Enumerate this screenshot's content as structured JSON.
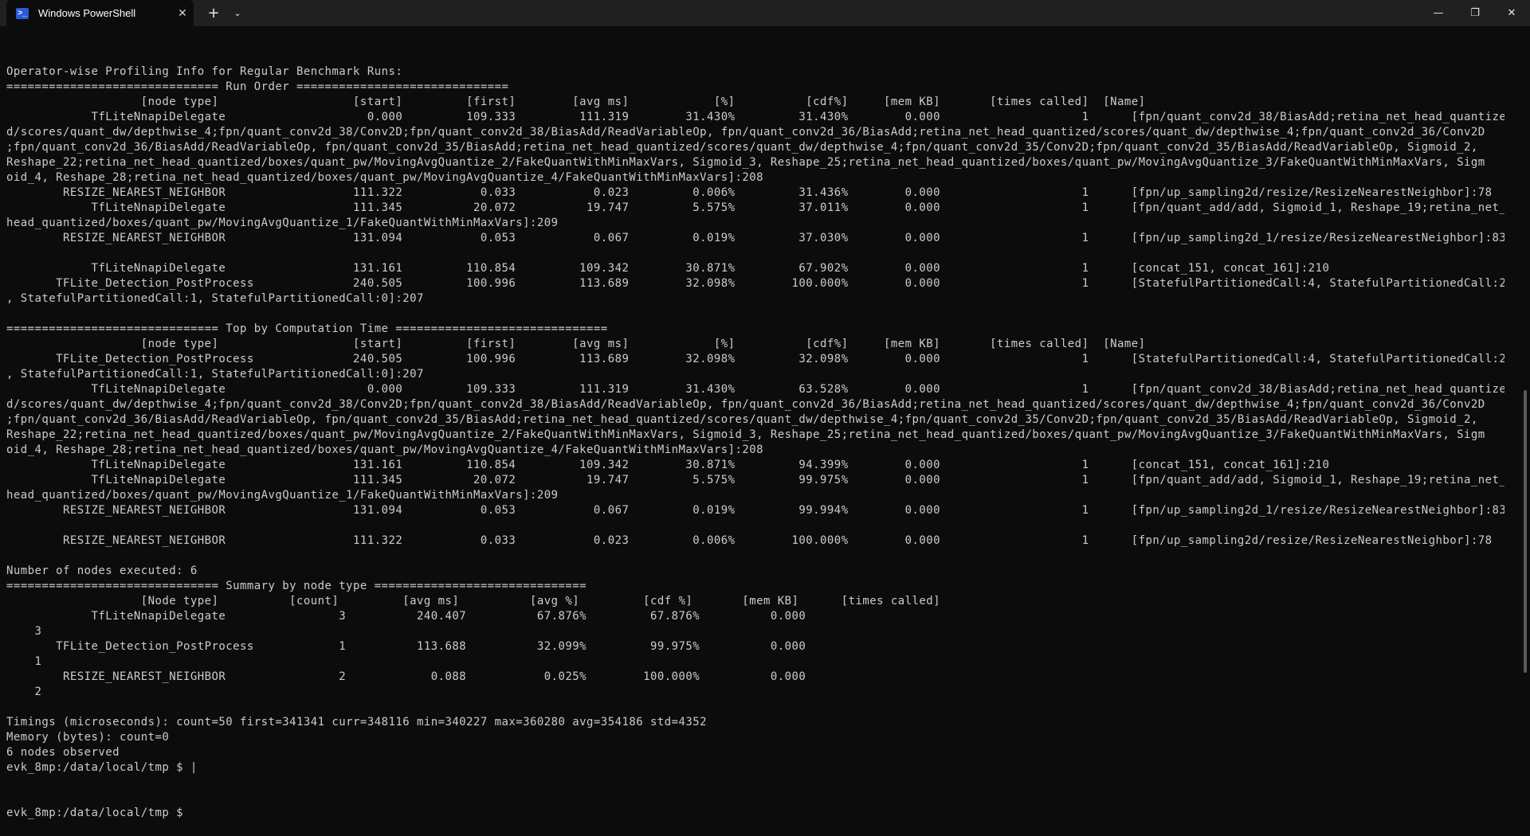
{
  "window": {
    "tab_title": "Windows PowerShell",
    "tab_icon": "powershell-icon",
    "close_tab_glyph": "✕",
    "new_tab_glyph": "+",
    "dropdown_glyph": "⌄",
    "minimize_glyph": "—",
    "maximize_glyph": "❐",
    "close_glyph": "✕"
  },
  "terminal": {
    "lines": [
      "Operator-wise Profiling Info for Regular Benchmark Runs:",
      "============================== Run Order ==============================",
      "                   [node type]                   [start]         [first]        [avg ms]            [%]          [cdf%]     [mem KB]       [times called]  [Name]",
      "            TfLiteNnapiDelegate                    0.000         109.333         111.319        31.430%         31.430%        0.000                    1      [fpn/quant_conv2d_38/BiasAdd;retina_net_head_quantize",
      "d/scores/quant_dw/depthwise_4;fpn/quant_conv2d_38/Conv2D;fpn/quant_conv2d_38/BiasAdd/ReadVariableOp, fpn/quant_conv2d_36/BiasAdd;retina_net_head_quantized/scores/quant_dw/depthwise_4;fpn/quant_conv2d_36/Conv2D",
      ";fpn/quant_conv2d_36/BiasAdd/ReadVariableOp, fpn/quant_conv2d_35/BiasAdd;retina_net_head_quantized/scores/quant_dw/depthwise_4;fpn/quant_conv2d_35/Conv2D;fpn/quant_conv2d_35/BiasAdd/ReadVariableOp, Sigmoid_2,",
      "Reshape_22;retina_net_head_quantized/boxes/quant_pw/MovingAvgQuantize_2/FakeQuantWithMinMaxVars, Sigmoid_3, Reshape_25;retina_net_head_quantized/boxes/quant_pw/MovingAvgQuantize_3/FakeQuantWithMinMaxVars, Sigm",
      "oid_4, Reshape_28;retina_net_head_quantized/boxes/quant_pw/MovingAvgQuantize_4/FakeQuantWithMinMaxVars]:208",
      "        RESIZE_NEAREST_NEIGHBOR                  111.322           0.033           0.023         0.006%         31.436%        0.000                    1      [fpn/up_sampling2d/resize/ResizeNearestNeighbor]:78",
      "            TfLiteNnapiDelegate                  111.345          20.072          19.747         5.575%         37.011%        0.000                    1      [fpn/quant_add/add, Sigmoid_1, Reshape_19;retina_net_",
      "head_quantized/boxes/quant_pw/MovingAvgQuantize_1/FakeQuantWithMinMaxVars]:209",
      "        RESIZE_NEAREST_NEIGHBOR                  131.094           0.053           0.067         0.019%         37.030%        0.000                    1      [fpn/up_sampling2d_1/resize/ResizeNearestNeighbor]:83",
      "",
      "            TfLiteNnapiDelegate                  131.161         110.854         109.342        30.871%         67.902%        0.000                    1      [concat_151, concat_161]:210",
      "       TFLite_Detection_PostProcess              240.505         100.996         113.689        32.098%        100.000%        0.000                    1      [StatefulPartitionedCall:4, StatefulPartitionedCall:2",
      ", StatefulPartitionedCall:1, StatefulPartitionedCall:0]:207",
      "",
      "============================== Top by Computation Time ==============================",
      "                   [node type]                   [start]         [first]        [avg ms]            [%]          [cdf%]     [mem KB]       [times called]  [Name]",
      "       TFLite_Detection_PostProcess              240.505         100.996         113.689        32.098%         32.098%        0.000                    1      [StatefulPartitionedCall:4, StatefulPartitionedCall:2",
      ", StatefulPartitionedCall:1, StatefulPartitionedCall:0]:207",
      "            TfLiteNnapiDelegate                    0.000         109.333         111.319        31.430%         63.528%        0.000                    1      [fpn/quant_conv2d_38/BiasAdd;retina_net_head_quantize",
      "d/scores/quant_dw/depthwise_4;fpn/quant_conv2d_38/Conv2D;fpn/quant_conv2d_38/BiasAdd/ReadVariableOp, fpn/quant_conv2d_36/BiasAdd;retina_net_head_quantized/scores/quant_dw/depthwise_4;fpn/quant_conv2d_36/Conv2D",
      ";fpn/quant_conv2d_36/BiasAdd/ReadVariableOp, fpn/quant_conv2d_35/BiasAdd;retina_net_head_quantized/scores/quant_dw/depthwise_4;fpn/quant_conv2d_35/Conv2D;fpn/quant_conv2d_35/BiasAdd/ReadVariableOp, Sigmoid_2,",
      "Reshape_22;retina_net_head_quantized/boxes/quant_pw/MovingAvgQuantize_2/FakeQuantWithMinMaxVars, Sigmoid_3, Reshape_25;retina_net_head_quantized/boxes/quant_pw/MovingAvgQuantize_3/FakeQuantWithMinMaxVars, Sigm",
      "oid_4, Reshape_28;retina_net_head_quantized/boxes/quant_pw/MovingAvgQuantize_4/FakeQuantWithMinMaxVars]:208",
      "            TfLiteNnapiDelegate                  131.161         110.854         109.342        30.871%         94.399%        0.000                    1      [concat_151, concat_161]:210",
      "            TfLiteNnapiDelegate                  111.345          20.072          19.747         5.575%         99.975%        0.000                    1      [fpn/quant_add/add, Sigmoid_1, Reshape_19;retina_net_",
      "head_quantized/boxes/quant_pw/MovingAvgQuantize_1/FakeQuantWithMinMaxVars]:209",
      "        RESIZE_NEAREST_NEIGHBOR                  131.094           0.053           0.067         0.019%         99.994%        0.000                    1      [fpn/up_sampling2d_1/resize/ResizeNearestNeighbor]:83",
      "",
      "        RESIZE_NEAREST_NEIGHBOR                  111.322           0.033           0.023         0.006%        100.000%        0.000                    1      [fpn/up_sampling2d/resize/ResizeNearestNeighbor]:78",
      "",
      "Number of nodes executed: 6",
      "============================== Summary by node type ==============================",
      "                   [Node type]          [count]         [avg ms]          [avg %]         [cdf %]       [mem KB]      [times called]",
      "            TfLiteNnapiDelegate                3          240.407          67.876%         67.876%          0.000",
      "    3",
      "       TFLite_Detection_PostProcess            1          113.688          32.099%         99.975%          0.000",
      "    1",
      "        RESIZE_NEAREST_NEIGHBOR                2            0.088           0.025%        100.000%          0.000",
      "    2",
      "",
      "Timings (microseconds): count=50 first=341341 curr=348116 min=340227 max=360280 avg=354186 std=4352",
      "Memory (bytes): count=0",
      "6 nodes observed",
      "evk_8mp:/data/local/tmp $ |",
      "",
      "",
      "evk_8mp:/data/local/tmp $"
    ]
  }
}
